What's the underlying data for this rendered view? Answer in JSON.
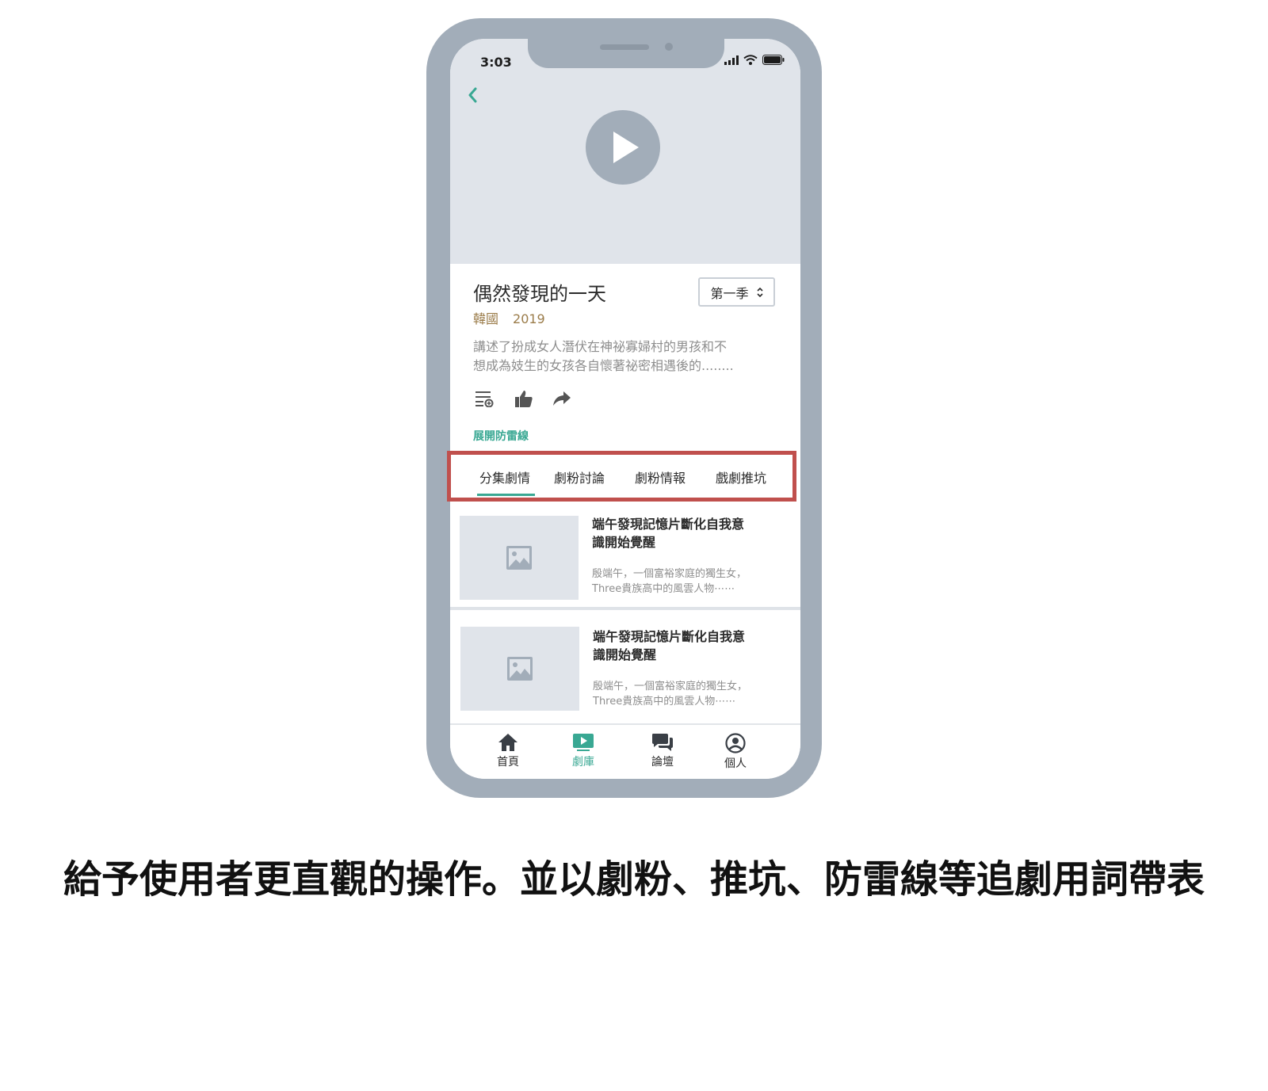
{
  "status_bar": {
    "time": "3:03"
  },
  "show": {
    "title": "偶然發現的一天",
    "season": "第一季",
    "country": "韓國",
    "year": "2019",
    "description_line1": "講述了扮成女人潛伏在神祕寡婦村的男孩和不",
    "description_line2": "想成為妓生的女孩各自懷著祕密相遇後的........",
    "spoiler_link": "展開防雷線"
  },
  "tabs": [
    {
      "label": "分集劇情",
      "active": true
    },
    {
      "label": "劇粉討論"
    },
    {
      "label": "劇粉情報"
    },
    {
      "label": "戲劇推坑"
    }
  ],
  "episodes": [
    {
      "title_line1": "端午發現記憶片斷化自我意",
      "title_line2": "識開始覺醒",
      "desc_line1": "殷端午，一個富裕家庭的獨生女，",
      "desc_line2": "Three貴族高中的風雲人物⋯⋯"
    },
    {
      "title_line1": "端午發現記憶片斷化自我意",
      "title_line2": "識開始覺醒",
      "desc_line1": "殷端午，一個富裕家庭的獨生女，",
      "desc_line2": "Three貴族高中的風雲人物⋯⋯"
    }
  ],
  "bottom_nav": [
    {
      "label": "首頁",
      "icon": "home-icon"
    },
    {
      "label": "劇庫",
      "icon": "play-library-icon",
      "active": true
    },
    {
      "label": "論壇",
      "icon": "chat-icon"
    },
    {
      "label": "個人",
      "icon": "person-icon"
    }
  ],
  "caption": "給予使用者更直觀的操作。並以劇粉、推坑、防雷線等追劇用詞帶表",
  "colors": {
    "accent": "#39a893",
    "frame": "#a2adb9",
    "placeholder": "#e0e4ea",
    "highlight": "#c0504d",
    "meta": "#9b7c4a"
  }
}
